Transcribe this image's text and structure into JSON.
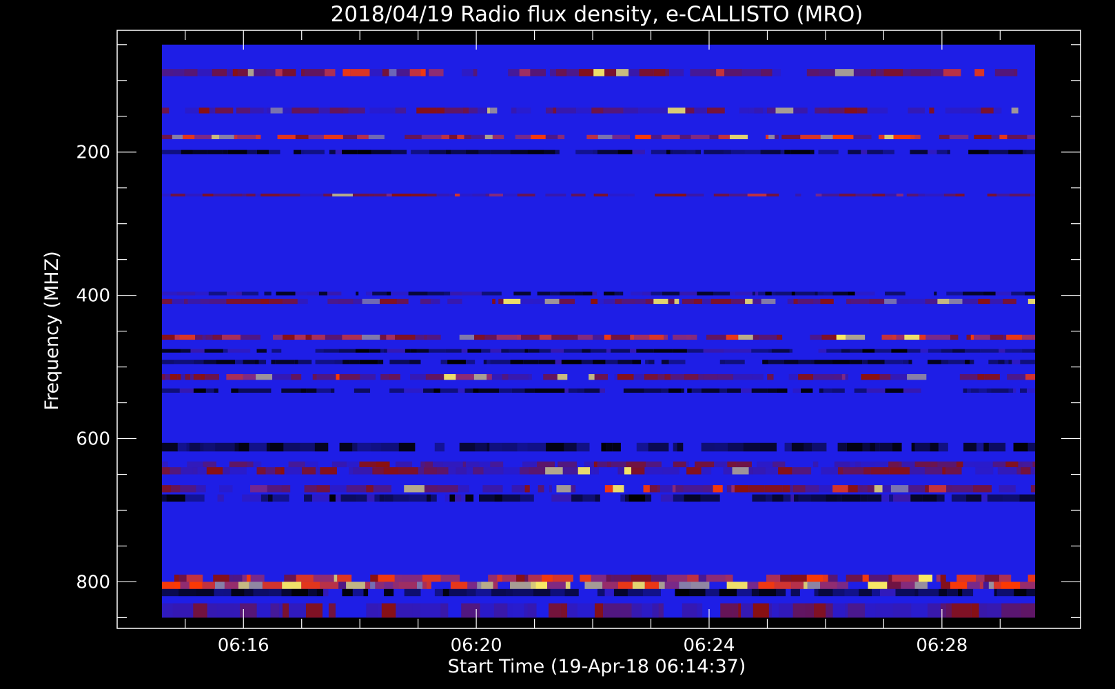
{
  "chart_data": {
    "type": "heatmap",
    "title": "2018/04/19  Radio flux density, e-CALLISTO (MRO)",
    "xlabel": "Start Time (19-Apr-18 06:14:37)",
    "ylabel": "Frequency (MHZ)",
    "x_tick_labels": [
      "06:16",
      "06:20",
      "06:24",
      "06:28"
    ],
    "x_ticks_min": [
      16,
      20,
      24,
      28
    ],
    "x_start_min": 14.6,
    "x_end_min": 29.6,
    "y_tick_labels": [
      "200",
      "400",
      "600",
      "800"
    ],
    "y_ticks": [
      200,
      400,
      600,
      800
    ],
    "ylim": [
      30,
      865
    ],
    "y_inverted": true,
    "data_ylim": [
      50,
      850
    ],
    "colors": {
      "background": "#000000",
      "low": "#000000",
      "base": "#1e1ee6",
      "mid": "#8a1010",
      "high": "#ff3a00",
      "peak": "#ffee60",
      "axes": "#ffffff"
    },
    "bands": [
      {
        "freq": [
          84,
          94
        ],
        "level": 0.62
      },
      {
        "freq": [
          138,
          146
        ],
        "level": 0.55
      },
      {
        "freq": [
          176,
          182
        ],
        "level": 0.78
      },
      {
        "freq": [
          197,
          203
        ],
        "level": 0.05
      },
      {
        "freq": [
          258,
          262
        ],
        "level": 0.6
      },
      {
        "freq": [
          395,
          400
        ],
        "level": 0.12
      },
      {
        "freq": [
          405,
          412
        ],
        "level": 0.55
      },
      {
        "freq": [
          455,
          462
        ],
        "level": 0.7
      },
      {
        "freq": [
          475,
          480
        ],
        "level": 0.1
      },
      {
        "freq": [
          490,
          496
        ],
        "level": 0.05
      },
      {
        "freq": [
          510,
          518
        ],
        "level": 0.58
      },
      {
        "freq": [
          530,
          536
        ],
        "level": 0.08
      },
      {
        "freq": [
          606,
          618
        ],
        "level": 0.02
      },
      {
        "freq": [
          632,
          640
        ],
        "level": 0.5
      },
      {
        "freq": [
          640,
          650
        ],
        "level": 0.55
      },
      {
        "freq": [
          665,
          675
        ],
        "level": 0.6
      },
      {
        "freq": [
          678,
          688
        ],
        "level": 0.1
      },
      {
        "freq": [
          790,
          800
        ],
        "level": 0.75
      },
      {
        "freq": [
          800,
          810
        ],
        "level": 0.85
      },
      {
        "freq": [
          810,
          820
        ],
        "level": 0.05
      },
      {
        "freq": [
          830,
          850
        ],
        "level": 0.45
      }
    ]
  }
}
